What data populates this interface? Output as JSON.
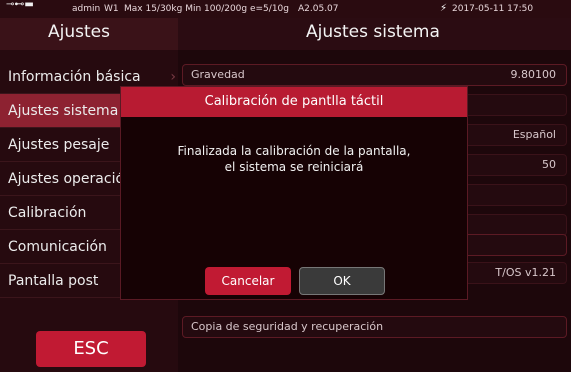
{
  "status_bar": {
    "user": "admin",
    "scale_id": "W1",
    "capacity": "Max 15/30kg Min 100/200g e=5/10g",
    "version": "A2.05.07",
    "datetime": "2017-05-11 17:50"
  },
  "left_header": {
    "title": "Ajustes"
  },
  "right_header": {
    "title": "Ajustes sistema"
  },
  "sidebar": {
    "items": [
      {
        "label": "Información básica"
      },
      {
        "label": "Ajustes sistema"
      },
      {
        "label": "Ajustes pesaje"
      },
      {
        "label": "Ajustes operación"
      },
      {
        "label": "Calibración"
      },
      {
        "label": "Comunicación"
      },
      {
        "label": "Pantalla post"
      }
    ],
    "esc_label": "ESC"
  },
  "settings": {
    "gravity_label": "Gravedad",
    "gravity_value": "9.80100",
    "language_value": "Español",
    "brightness_value": "50",
    "version_value": "T/OS v1.21",
    "backup_label": "Copia de seguridad y recuperación"
  },
  "dialog": {
    "title": "Calibración de pantlla táctil",
    "message_line1": "Finalizada la calibración de la pantalla,",
    "message_line2": "el sistema se reiniciará",
    "cancel_label": "Cancelar",
    "ok_label": "OK"
  },
  "colors": {
    "accent": "#c11a33",
    "sidebar_active": "#8d2231",
    "background": "#1a0507"
  }
}
